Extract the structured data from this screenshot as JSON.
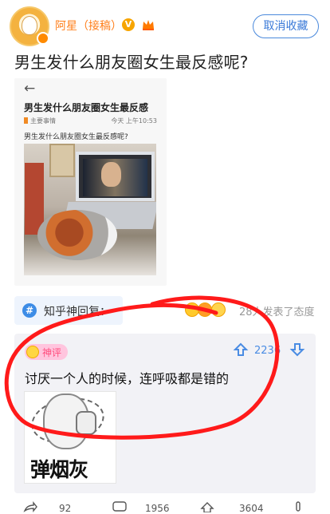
{
  "header": {
    "username": "阿星（接稿）",
    "verified_label": "V",
    "unfollow_label": "取消收藏"
  },
  "post": {
    "title": "男生发什么朋友圈女生最反感呢?"
  },
  "screenshot_card": {
    "title": "男生发什么朋友圈女生最反感",
    "topic": "主要事情",
    "time": "今天 上午10:53",
    "question": "男生发什么朋友圈女生最反感呢?"
  },
  "discussion": {
    "tag_label": "知乎神回复：",
    "reaction_count": "28人发表了态度"
  },
  "comment": {
    "badge": "神评",
    "like_count": "2236",
    "text": "讨厌一个人的时候，连呼吸都是错的",
    "meme_text": "弹烟灰"
  },
  "bottom": {
    "share_count": "92",
    "comment_count": "1956",
    "like_count": "3604"
  },
  "colors": {
    "accent": "#3b7ad8",
    "username": "#ff7f1b",
    "annotation": "#ff1a1a",
    "hot_badge": "#ffc5de"
  }
}
